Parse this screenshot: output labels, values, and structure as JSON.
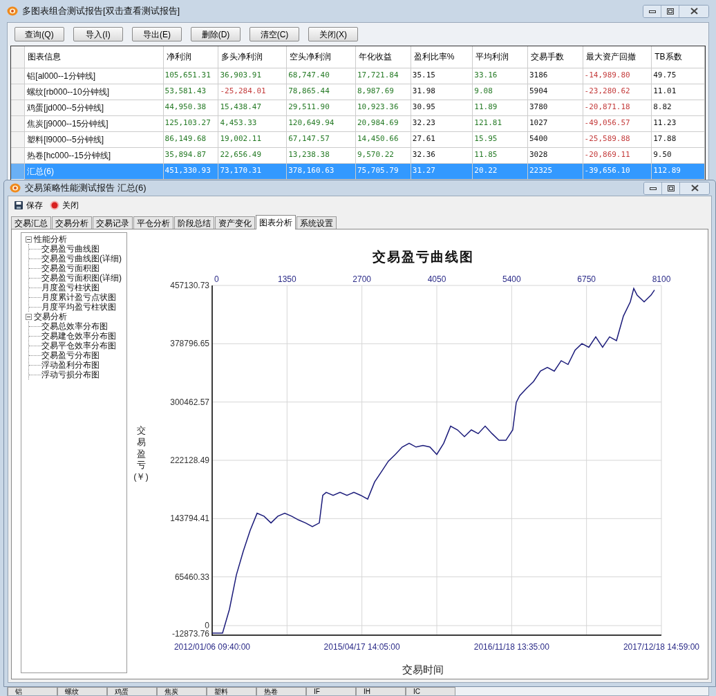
{
  "back_window": {
    "title": "多图表组合测试报告[双击查看测试报告]",
    "buttons": [
      "查询(Q)",
      "导入(I)",
      "导出(E)",
      "删除(D)",
      "清空(C)",
      "关闭(X)"
    ],
    "table": {
      "columns": [
        "图表信息",
        "净利润",
        "多头净利润",
        "空头净利润",
        "年化收益",
        "盈利比率%",
        "平均利润",
        "交易手数",
        "最大资产回撤",
        "TB系数"
      ],
      "rows": [
        {
          "selected": false,
          "cells": [
            {
              "text": "铝[al000--1分钟线]"
            },
            {
              "text": "105,651.31",
              "color": "#257a25"
            },
            {
              "text": "36,903.91",
              "color": "#257a25"
            },
            {
              "text": "68,747.40",
              "color": "#257a25"
            },
            {
              "text": "17,721.84",
              "color": "#257a25"
            },
            {
              "text": "35.15"
            },
            {
              "text": "33.16",
              "color": "#257a25"
            },
            {
              "text": "3186"
            },
            {
              "text": "-14,989.80",
              "color": "#c43c3c"
            },
            {
              "text": "49.75"
            }
          ]
        },
        {
          "selected": false,
          "cells": [
            {
              "text": "螺纹[rb000--10分钟线]"
            },
            {
              "text": "53,581.43",
              "color": "#257a25"
            },
            {
              "text": "-25,284.01",
              "color": "#c43c3c"
            },
            {
              "text": "78,865.44",
              "color": "#257a25"
            },
            {
              "text": "8,987.69",
              "color": "#257a25"
            },
            {
              "text": "31.98"
            },
            {
              "text": "9.08",
              "color": "#257a25"
            },
            {
              "text": "5904"
            },
            {
              "text": "-23,280.62",
              "color": "#c43c3c"
            },
            {
              "text": "11.01"
            }
          ]
        },
        {
          "selected": false,
          "cells": [
            {
              "text": "鸡蛋[jd000--5分钟线]"
            },
            {
              "text": "44,950.38",
              "color": "#257a25"
            },
            {
              "text": "15,438.47",
              "color": "#257a25"
            },
            {
              "text": "29,511.90",
              "color": "#257a25"
            },
            {
              "text": "10,923.36",
              "color": "#257a25"
            },
            {
              "text": "30.95"
            },
            {
              "text": "11.89",
              "color": "#257a25"
            },
            {
              "text": "3780"
            },
            {
              "text": "-20,871.18",
              "color": "#c43c3c"
            },
            {
              "text": "8.82"
            }
          ]
        },
        {
          "selected": false,
          "cells": [
            {
              "text": "焦炭[j9000--15分钟线]"
            },
            {
              "text": "125,103.27",
              "color": "#257a25"
            },
            {
              "text": "4,453.33",
              "color": "#257a25"
            },
            {
              "text": "120,649.94",
              "color": "#257a25"
            },
            {
              "text": "20,984.69",
              "color": "#257a25"
            },
            {
              "text": "32.23"
            },
            {
              "text": "121.81",
              "color": "#257a25"
            },
            {
              "text": "1027"
            },
            {
              "text": "-49,056.57",
              "color": "#c43c3c"
            },
            {
              "text": "11.23"
            }
          ]
        },
        {
          "selected": false,
          "cells": [
            {
              "text": "塑料[l9000--5分钟线]"
            },
            {
              "text": "86,149.68",
              "color": "#257a25"
            },
            {
              "text": "19,002.11",
              "color": "#257a25"
            },
            {
              "text": "67,147.57",
              "color": "#257a25"
            },
            {
              "text": "14,450.66",
              "color": "#257a25"
            },
            {
              "text": "27.61"
            },
            {
              "text": "15.95",
              "color": "#257a25"
            },
            {
              "text": "5400"
            },
            {
              "text": "-25,589.88",
              "color": "#c43c3c"
            },
            {
              "text": "17.88"
            }
          ]
        },
        {
          "selected": false,
          "cells": [
            {
              "text": "热卷[hc000--15分钟线]"
            },
            {
              "text": "35,894.87",
              "color": "#257a25"
            },
            {
              "text": "22,656.49",
              "color": "#257a25"
            },
            {
              "text": "13,238.38",
              "color": "#257a25"
            },
            {
              "text": "9,570.22",
              "color": "#257a25"
            },
            {
              "text": "32.36"
            },
            {
              "text": "11.85",
              "color": "#257a25"
            },
            {
              "text": "3028"
            },
            {
              "text": "-20,869.11",
              "color": "#c43c3c"
            },
            {
              "text": "9.50"
            }
          ]
        },
        {
          "selected": true,
          "cells": [
            {
              "text": "汇总(6)"
            },
            {
              "text": "451,330.93"
            },
            {
              "text": "73,170.31"
            },
            {
              "text": "378,160.63"
            },
            {
              "text": "75,705.79"
            },
            {
              "text": "31.27"
            },
            {
              "text": "20.22"
            },
            {
              "text": "22325"
            },
            {
              "text": "-39,656.10"
            },
            {
              "text": "112.89"
            }
          ]
        }
      ]
    },
    "bottom_tabs": [
      "铝",
      "螺纹",
      "鸡蛋",
      "焦炭",
      "塑料",
      "热卷",
      "IF",
      "IH",
      "IC"
    ]
  },
  "front_window": {
    "title": "交易策略性能测试报告 汇总(6)",
    "toolbar": [
      "保存",
      "关闭"
    ],
    "tabs": [
      {
        "label": "交易汇总",
        "selected": false
      },
      {
        "label": "交易分析",
        "selected": false
      },
      {
        "label": "交易记录",
        "selected": false
      },
      {
        "label": "平仓分析",
        "selected": false
      },
      {
        "label": "阶段总结",
        "selected": false
      },
      {
        "label": "资产变化",
        "selected": false
      },
      {
        "label": "图表分析",
        "selected": true
      },
      {
        "label": "系统设置",
        "selected": false
      }
    ],
    "tree": [
      {
        "label": "性能分析",
        "expanded": true,
        "children": [
          {
            "label": "交易盈亏曲线图"
          },
          {
            "label": "交易盈亏曲线图(详细)"
          },
          {
            "label": "交易盈亏面积图"
          },
          {
            "label": "交易盈亏面积图(详细)"
          },
          {
            "label": "月度盈亏柱状图"
          },
          {
            "label": "月度累计盈亏点状图"
          },
          {
            "label": "月度平均盈亏柱状图"
          }
        ]
      },
      {
        "label": "交易分析",
        "expanded": true,
        "children": [
          {
            "label": "交易总效率分布图"
          },
          {
            "label": "交易建仓效率分布图"
          },
          {
            "label": "交易平仓效率分布图"
          },
          {
            "label": "交易盈亏分布图"
          },
          {
            "label": "浮动盈利分布图"
          },
          {
            "label": "浮动亏损分布图"
          }
        ]
      }
    ],
    "chart": {
      "date_labels": [
        "2012/01/06 09:40:00",
        "2015/04/17 14:05:00",
        "2016/11/18 13:35:00",
        "2017/12/18 14:59:00"
      ],
      "chart_data": {
        "type": "line",
        "title": "交易盈亏曲线图",
        "xlabel": "交易时间",
        "ylabel": "交易盈亏(￥)",
        "x": [
          0,
          187,
          312,
          436,
          561,
          686,
          810,
          935,
          1060,
          1184,
          1309,
          1433,
          1558,
          1683,
          1807,
          1932,
          1994,
          2056,
          2181,
          2305,
          2430,
          2555,
          2679,
          2804,
          2928,
          3053,
          3178,
          3302,
          3427,
          3551,
          3676,
          3801,
          3925,
          4050,
          4174,
          4299,
          4424,
          4548,
          4673,
          4797,
          4922,
          5047,
          5171,
          5296,
          5420,
          5483,
          5545,
          5670,
          5794,
          5919,
          6044,
          6168,
          6293,
          6417,
          6542,
          6667,
          6791,
          6916,
          7040,
          7165,
          7290,
          7414,
          7539,
          7601,
          7663,
          7788,
          7912,
          7975
        ],
        "series": [
          {
            "color": "#1b1b7a",
            "values": [
              -10000,
              -10000,
              22000,
              68000,
              100000,
              128000,
              151000,
              147000,
              138000,
              147000,
              151000,
              147000,
              142000,
              138000,
              133000,
              138000,
              175000,
              179000,
              175000,
              179000,
              175000,
              179000,
              175000,
              170000,
              193000,
              207000,
              221000,
              230000,
              240000,
              245000,
              240000,
              242000,
              240000,
              230000,
              245000,
              268000,
              263000,
              254000,
              263000,
              258000,
              268000,
              258000,
              249000,
              249000,
              263000,
              300000,
              309000,
              319000,
              328000,
              342000,
              347000,
              342000,
              356000,
              351000,
              370000,
              379000,
              374000,
              388000,
              374000,
              388000,
              383000,
              416000,
              435000,
              453000,
              444000,
              435000,
              444000,
              451000
            ]
          }
        ],
        "grid": true,
        "xlim": [
          0,
          8100
        ],
        "ylim": [
          -12873.76,
          457130.73
        ],
        "xticks": [
          0,
          1350,
          2700,
          4050,
          5400,
          6750,
          8100
        ],
        "yticks": [
          457130.73,
          378796.65,
          300462.57,
          222128.49,
          143794.41,
          65460.33,
          0,
          -12873.76
        ]
      }
    }
  }
}
